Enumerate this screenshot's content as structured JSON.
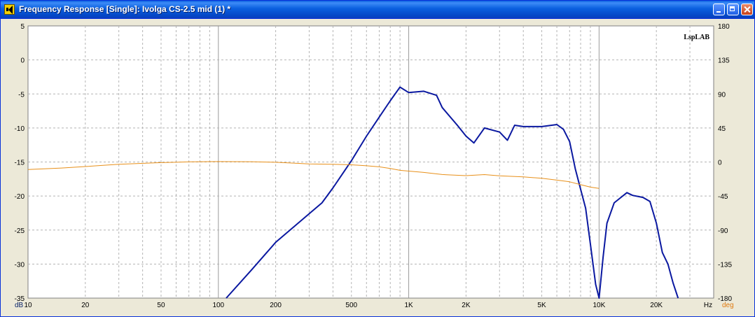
{
  "window": {
    "title": "Frequency Response [Single]: Ivolga CS-2.5 mid (1) *",
    "buttons": {
      "minimize": "minimize-icon",
      "maximize": "maximize-icon",
      "close": "close-icon"
    }
  },
  "chart_data": {
    "type": "line",
    "watermark": "LspLAB",
    "xscale": "log",
    "xlim": [
      10,
      40000
    ],
    "x_ticks": [
      {
        "v": 10,
        "label": "10"
      },
      {
        "v": 20,
        "label": "20"
      },
      {
        "v": 50,
        "label": "50"
      },
      {
        "v": 100,
        "label": "100"
      },
      {
        "v": 200,
        "label": "200"
      },
      {
        "v": 500,
        "label": "500"
      },
      {
        "v": 1000,
        "label": "1K"
      },
      {
        "v": 2000,
        "label": "2K"
      },
      {
        "v": 5000,
        "label": "5K"
      },
      {
        "v": 10000,
        "label": "10K"
      },
      {
        "v": 20000,
        "label": "20K"
      }
    ],
    "x_unit": "Hz",
    "y_left": {
      "unit": "dB",
      "ylim": [
        -35,
        5
      ],
      "ticks": [
        5,
        0,
        -5,
        -10,
        -15,
        -20,
        -25,
        -30,
        -35
      ],
      "color": "#0a246a"
    },
    "y_right": {
      "unit": "deg",
      "ylim": [
        -180,
        180
      ],
      "ticks": [
        180,
        135,
        90,
        45,
        0,
        -45,
        -90,
        -135,
        -180
      ],
      "color": "#e07a10"
    },
    "grid": true,
    "series": [
      {
        "axis": "left",
        "color": "#0a18a0",
        "points": [
          [
            110,
            -35
          ],
          [
            150,
            -30.8
          ],
          [
            200,
            -26.8
          ],
          [
            300,
            -22.6
          ],
          [
            350,
            -21
          ],
          [
            400,
            -18.8
          ],
          [
            500,
            -14.8
          ],
          [
            600,
            -11.2
          ],
          [
            700,
            -8.4
          ],
          [
            800,
            -6
          ],
          [
            900,
            -4
          ],
          [
            1000,
            -4.8
          ],
          [
            1200,
            -4.6
          ],
          [
            1400,
            -5.2
          ],
          [
            1500,
            -7
          ],
          [
            1800,
            -9.6
          ],
          [
            2000,
            -11.2
          ],
          [
            2200,
            -12.2
          ],
          [
            2500,
            -10
          ],
          [
            3000,
            -10.6
          ],
          [
            3300,
            -11.8
          ],
          [
            3600,
            -9.6
          ],
          [
            4000,
            -9.8
          ],
          [
            5000,
            -9.8
          ],
          [
            6000,
            -9.5
          ],
          [
            6500,
            -10.2
          ],
          [
            7000,
            -12
          ],
          [
            7500,
            -16
          ],
          [
            8000,
            -19
          ],
          [
            8500,
            -21.8
          ],
          [
            9000,
            -27
          ],
          [
            9600,
            -33
          ],
          [
            10000,
            -35
          ],
          [
            10500,
            -29
          ],
          [
            11000,
            -24
          ],
          [
            12000,
            -21
          ],
          [
            14000,
            -19.5
          ],
          [
            15000,
            -19.9
          ],
          [
            17000,
            -20.2
          ],
          [
            18500,
            -20.8
          ],
          [
            20000,
            -24
          ],
          [
            21500,
            -28.3
          ],
          [
            23000,
            -30
          ],
          [
            24500,
            -32.8
          ],
          [
            26000,
            -35
          ]
        ]
      },
      {
        "axis": "right",
        "color": "#e8901a",
        "points": [
          [
            10,
            -10
          ],
          [
            15,
            -8
          ],
          [
            20,
            -6
          ],
          [
            30,
            -3
          ],
          [
            50,
            -0.8
          ],
          [
            70,
            0.2
          ],
          [
            100,
            0.6
          ],
          [
            150,
            0.4
          ],
          [
            200,
            -0.4
          ],
          [
            300,
            -2.6
          ],
          [
            400,
            -3
          ],
          [
            500,
            -3.7
          ],
          [
            600,
            -5
          ],
          [
            700,
            -6.4
          ],
          [
            800,
            -8.5
          ],
          [
            900,
            -11
          ],
          [
            1000,
            -12
          ],
          [
            1200,
            -13.8
          ],
          [
            1500,
            -16.6
          ],
          [
            2000,
            -18
          ],
          [
            2500,
            -16.7
          ],
          [
            3000,
            -18.3
          ],
          [
            4000,
            -19.6
          ],
          [
            5000,
            -21.6
          ],
          [
            6000,
            -24
          ],
          [
            7000,
            -26.2
          ],
          [
            8000,
            -30
          ],
          [
            9000,
            -33.2
          ],
          [
            10000,
            -35
          ]
        ]
      }
    ]
  }
}
